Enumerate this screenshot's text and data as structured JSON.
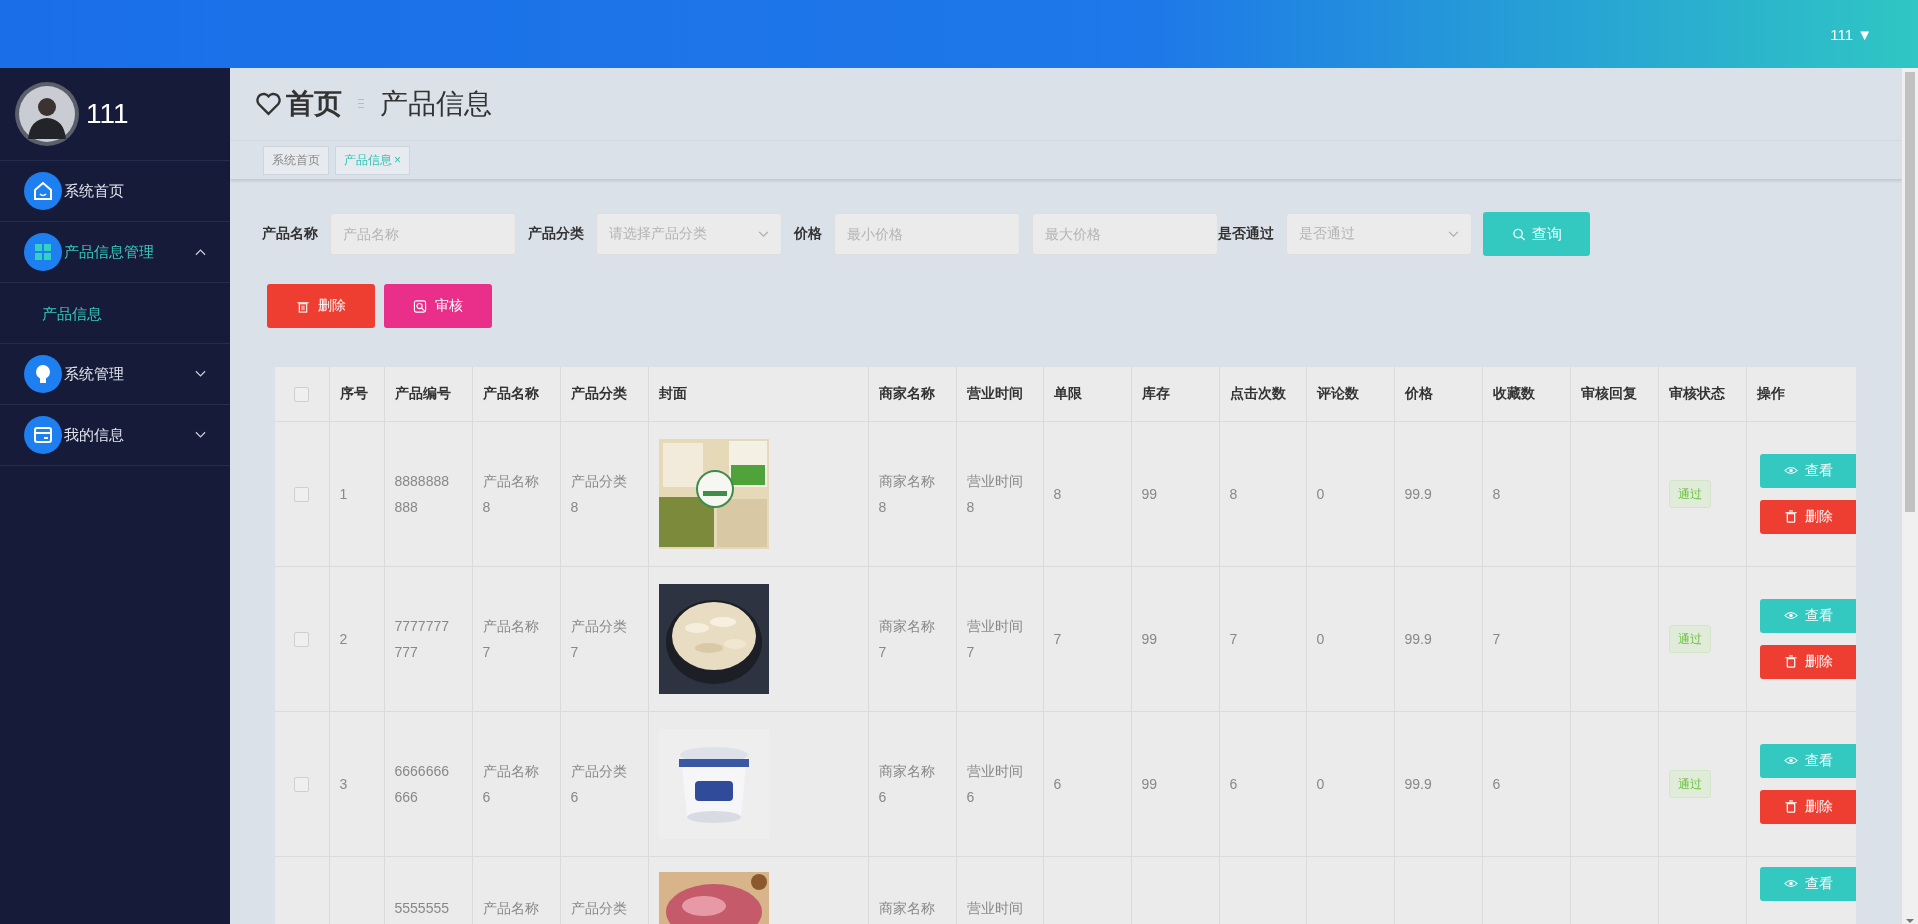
{
  "header": {
    "user": "111",
    "caret": "▼"
  },
  "sidebar": {
    "user": "111",
    "items": [
      {
        "label": "系统首页",
        "kind": "link",
        "selected": false
      },
      {
        "label": "产品信息管理",
        "kind": "group",
        "expanded": true,
        "selected": true,
        "children": [
          {
            "label": "产品信息",
            "selected": true
          }
        ]
      },
      {
        "label": "系统管理",
        "kind": "group",
        "expanded": false,
        "selected": false
      },
      {
        "label": "我的信息",
        "kind": "group",
        "expanded": false,
        "selected": false
      }
    ]
  },
  "page_title": {
    "home": "首页",
    "current": "产品信息"
  },
  "tabs": [
    {
      "label": "系统首页",
      "selected": false
    },
    {
      "label": "产品信息",
      "selected": true,
      "close": "×"
    }
  ],
  "filters": [
    {
      "label": "产品名称",
      "kind": "text",
      "placeholder": "产品名称"
    },
    {
      "label": "产品分类",
      "kind": "select",
      "placeholder": "请选择产品分类"
    },
    {
      "label": "价格",
      "kind": "text",
      "placeholder": "最小价格"
    },
    {
      "kind": "text",
      "placeholder": "最大价格"
    },
    {
      "label": "是否通过",
      "kind": "select",
      "placeholder": "是否通过"
    }
  ],
  "search_button": "查询",
  "actions": [
    {
      "label": "删除",
      "kind": "delete"
    },
    {
      "label": "审核",
      "kind": "audit"
    }
  ],
  "table": {
    "select_all": {
      "checked": false
    },
    "columns": [
      "序号",
      "产品编号",
      "产品名称",
      "产品分类",
      "封面",
      "商家名称",
      "营业时间",
      "单限",
      "库存",
      "点击次数",
      "评论数",
      "价格",
      "收藏数",
      "审核回复",
      "审核状态",
      "操作"
    ],
    "rows": [
      {
        "checked": false,
        "index": "1",
        "code": "8888888888",
        "name": "产品名称8",
        "category": "产品分类8",
        "cover": {
          "kind": "picture"
        },
        "merchant": "商家名称8",
        "hours": "营业时间8",
        "limit": "8",
        "stock": "99",
        "clicks": "8",
        "comments": "0",
        "price": "99.9",
        "favorites": "8",
        "status": "通过",
        "buttons": [
          {
            "label": "查看",
            "kind": "view"
          },
          {
            "label": "删除",
            "kind": "delete"
          }
        ]
      },
      {
        "checked": false,
        "index": "2",
        "code": "7777777777",
        "name": "产品名称7",
        "category": "产品分类7",
        "cover": {
          "kind": "picture"
        },
        "merchant": "商家名称7",
        "hours": "营业时间7",
        "limit": "7",
        "stock": "99",
        "clicks": "7",
        "comments": "0",
        "price": "99.9",
        "favorites": "7",
        "status": "通过",
        "buttons": [
          {
            "label": "查看",
            "kind": "view"
          },
          {
            "label": "删除",
            "kind": "delete"
          }
        ]
      },
      {
        "checked": false,
        "index": "3",
        "code": "6666666666",
        "name": "产品名称6",
        "category": "产品分类6",
        "cover": {
          "kind": "picture"
        },
        "merchant": "商家名称6",
        "hours": "营业时间6",
        "limit": "6",
        "stock": "99",
        "clicks": "6",
        "comments": "0",
        "price": "99.9",
        "favorites": "6",
        "status": "通过",
        "buttons": [
          {
            "label": "查看",
            "kind": "view"
          },
          {
            "label": "删除",
            "kind": "delete"
          }
        ]
      },
      {
        "code": "5555555",
        "name": "产品名称",
        "category": "产品分类",
        "cover": {
          "kind": "picture"
        },
        "merchant": "商家名称",
        "hours": "营业时间",
        "buttons": [
          {
            "label": "查看",
            "kind": "view"
          }
        ]
      }
    ]
  }
}
